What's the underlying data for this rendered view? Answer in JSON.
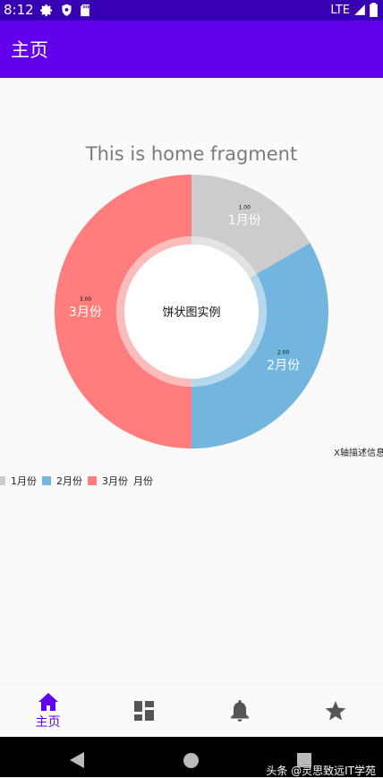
{
  "status": {
    "time": "8:12",
    "network": "LTE"
  },
  "app_bar": {
    "title": "主页"
  },
  "home_text": "This is home fragment",
  "chart_data": {
    "type": "pie",
    "style": "donut",
    "center_text": "饼状图实例",
    "description": "X轴描述信息",
    "legend_label": "月份",
    "legend_position": "bottom-left",
    "slices": [
      {
        "label": "1月份",
        "value": 1,
        "value_text": "1.00",
        "color": "#cccccc"
      },
      {
        "label": "2月份",
        "value": 2,
        "value_text": "2.00",
        "color": "#72b6e0"
      },
      {
        "label": "3月份",
        "value": 3,
        "value_text": "3.00",
        "color": "#ff7d7d"
      }
    ]
  },
  "bottom_nav": [
    {
      "label": "主页",
      "icon": "home-icon",
      "active": true
    },
    {
      "label": "",
      "icon": "dashboard-icon",
      "active": false
    },
    {
      "label": "",
      "icon": "bell-icon",
      "active": false
    },
    {
      "label": "",
      "icon": "star-icon",
      "active": false
    }
  ],
  "colors": {
    "status_bar": "#3700b3",
    "primary": "#6200ee",
    "inactive_icon": "#555555"
  },
  "watermark": "头条 @灵思致远IT学苑"
}
